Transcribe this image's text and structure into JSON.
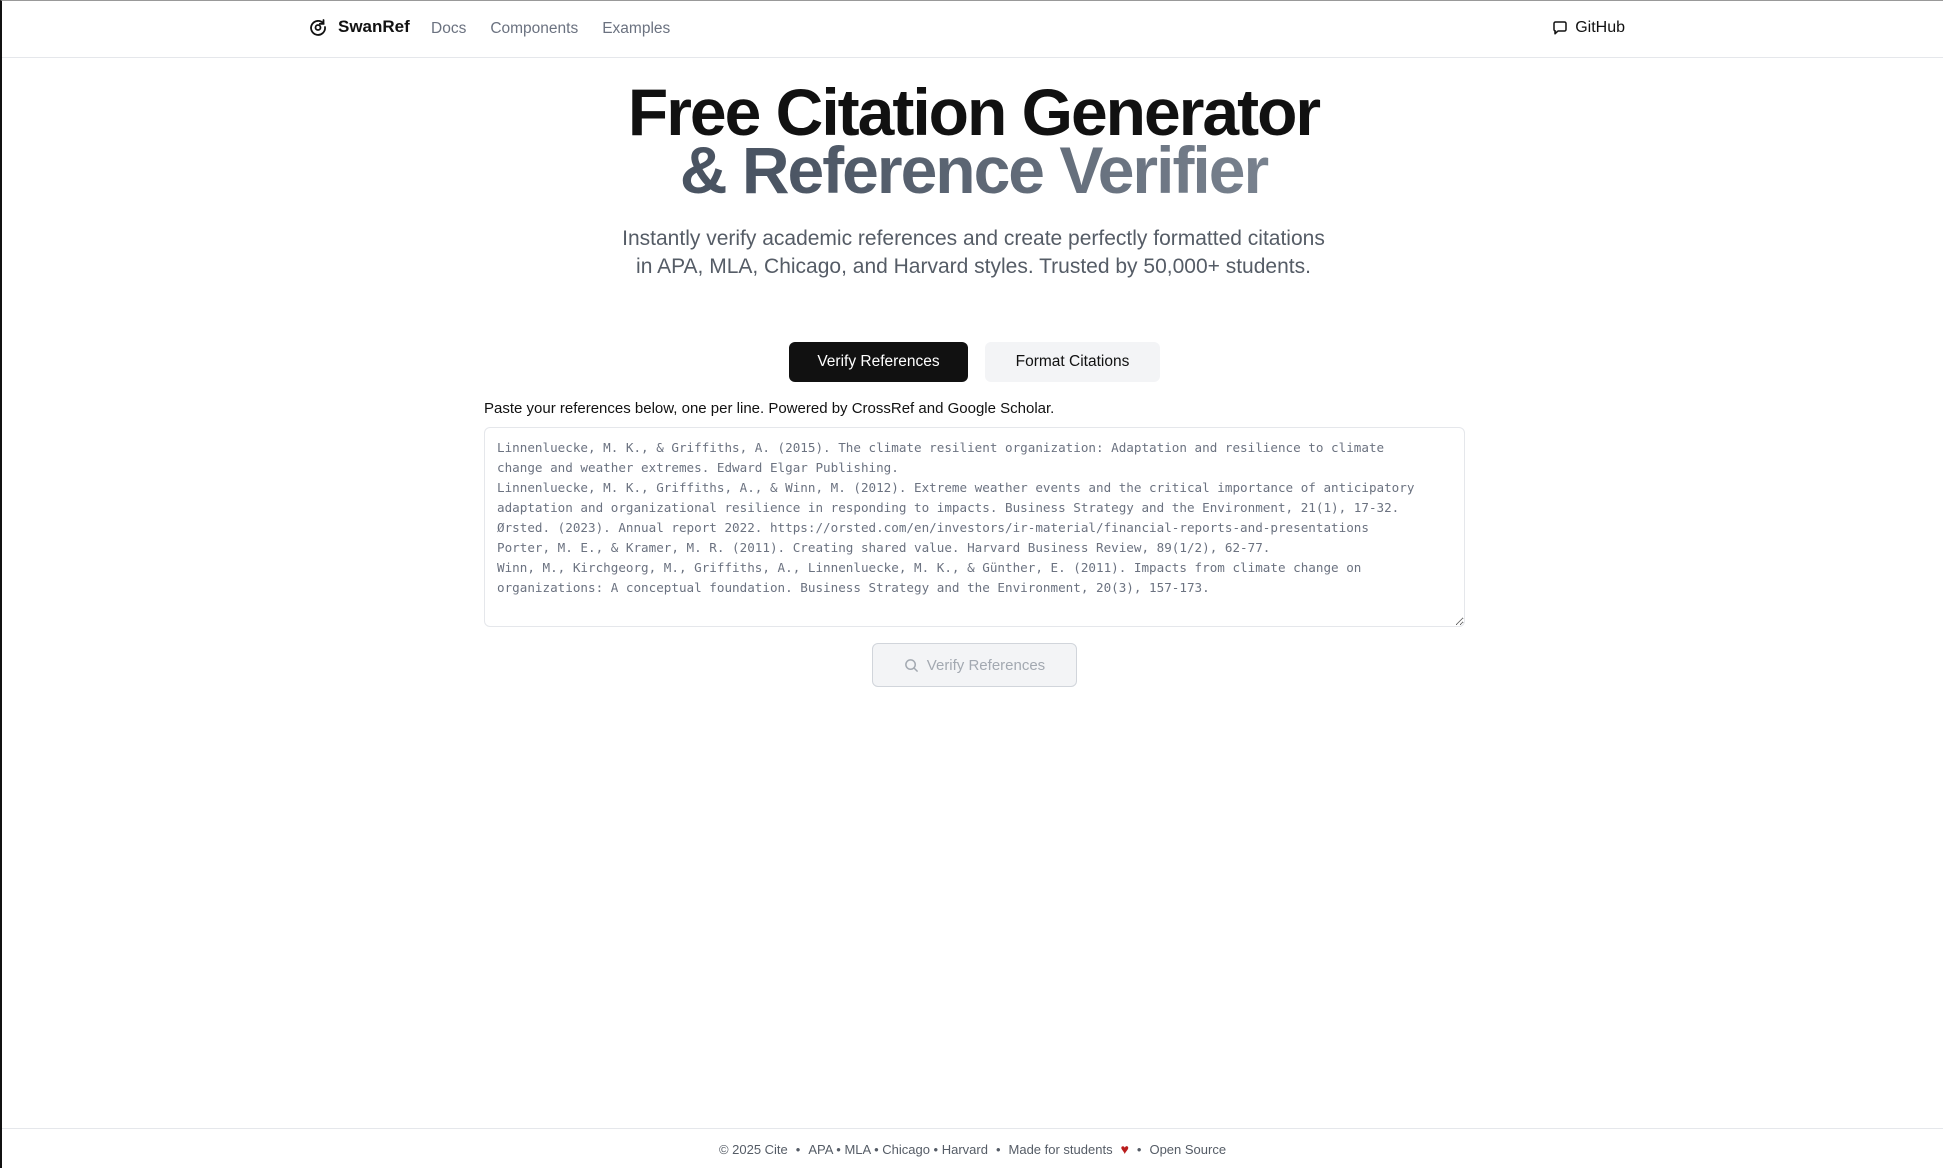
{
  "navbar": {
    "brand": "SwanRef",
    "links": [
      "Docs",
      "Components",
      "Examples"
    ],
    "github": "GitHub"
  },
  "hero": {
    "line1": "Free Citation Generator",
    "line2": "& Reference Verifier",
    "subtitle": "Instantly verify academic references and create perfectly formatted citations in APA, MLA, Chicago, and Harvard styles. Trusted by 50,000+ students."
  },
  "tabs": {
    "verify": "Verify References",
    "format": "Format Citations"
  },
  "helper": "Paste your references below, one per line. Powered by CrossRef and Google Scholar.",
  "references": "Linnenluecke, M. K., & Griffiths, A. (2015). The climate resilient organization: Adaptation and resilience to climate\nchange and weather extremes. Edward Elgar Publishing.\nLinnenluecke, M. K., Griffiths, A., & Winn, M. (2012). Extreme weather events and the critical importance of anticipatory\nadaptation and organizational resilience in responding to impacts. Business Strategy and the Environment, 21(1), 17-32.\nØrsted. (2023). Annual report 2022. https://orsted.com/en/investors/ir-material/financial-reports-and-presentations\nPorter, M. E., & Kramer, M. R. (2011). Creating shared value. Harvard Business Review, 89(1/2), 62-77.\nWinn, M., Kirchgeorg, M., Griffiths, A., Linnenluecke, M. K., & Günther, E. (2011). Impacts from climate change on\norganizations: A conceptual foundation. Business Strategy and the Environment, 20(3), 157-173.",
  "verify_button": "Verify References",
  "footer": {
    "copyright": "© 2025 Cite",
    "sep": "•",
    "styles": "APA • MLA • Chicago • Harvard",
    "made_for": "Made for students",
    "heart": "♥",
    "open_source": "Open Source"
  },
  "icons": {
    "brand": "swan-logo-icon",
    "github": "message-square-icon",
    "search": "search-icon"
  }
}
